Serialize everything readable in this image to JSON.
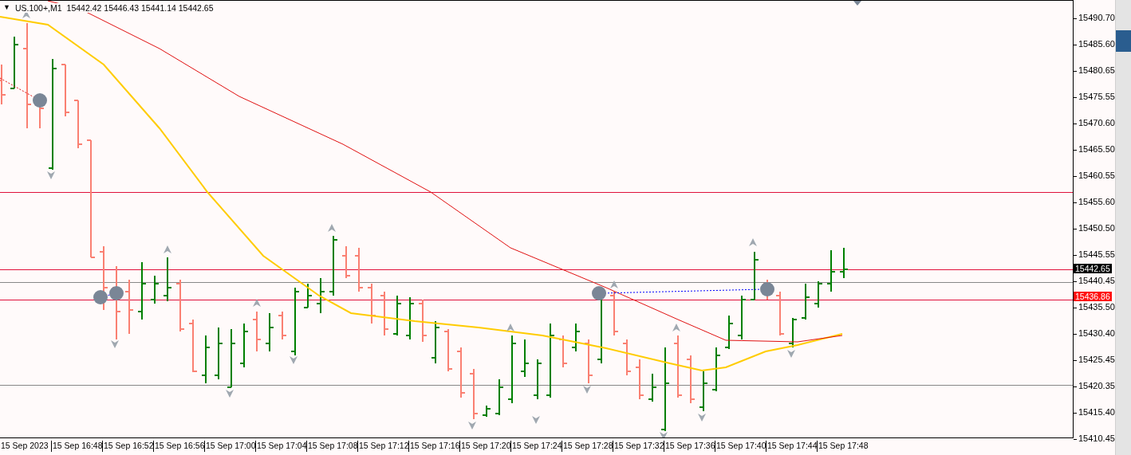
{
  "chart": {
    "menu_glyph": "▼",
    "symbol": "US.100+,M1",
    "quote": "15442.42 15446.43 15441.14 15442.65",
    "price_axis": [
      "15490.70",
      "15485.60",
      "15480.65",
      "15475.55",
      "15470.60",
      "15465.50",
      "15460.55",
      "15455.60",
      "15450.50",
      "15445.55",
      "15440.45",
      "15435.50",
      "15430.40",
      "15425.45",
      "15420.35",
      "15415.40",
      "15410.45"
    ],
    "price_tags": [
      {
        "kind": "bid",
        "text": "15442.65"
      },
      {
        "kind": "level",
        "text": "15436.86"
      }
    ],
    "time_axis": [
      "15 Sep 2023",
      "15 Sep 16:48",
      "15 Sep 16:52",
      "15 Sep 16:56",
      "15 Sep 17:00",
      "15 Sep 17:04",
      "15 Sep 17:08",
      "15 Sep 17:12",
      "15 Sep 17:16",
      "15 Sep 17:20",
      "15 Sep 17:24",
      "15 Sep 17:28",
      "15 Sep 17:32",
      "15 Sep 17:36",
      "15 Sep 17:40",
      "15 Sep 17:44",
      "15 Sep 17:48"
    ]
  }
}
